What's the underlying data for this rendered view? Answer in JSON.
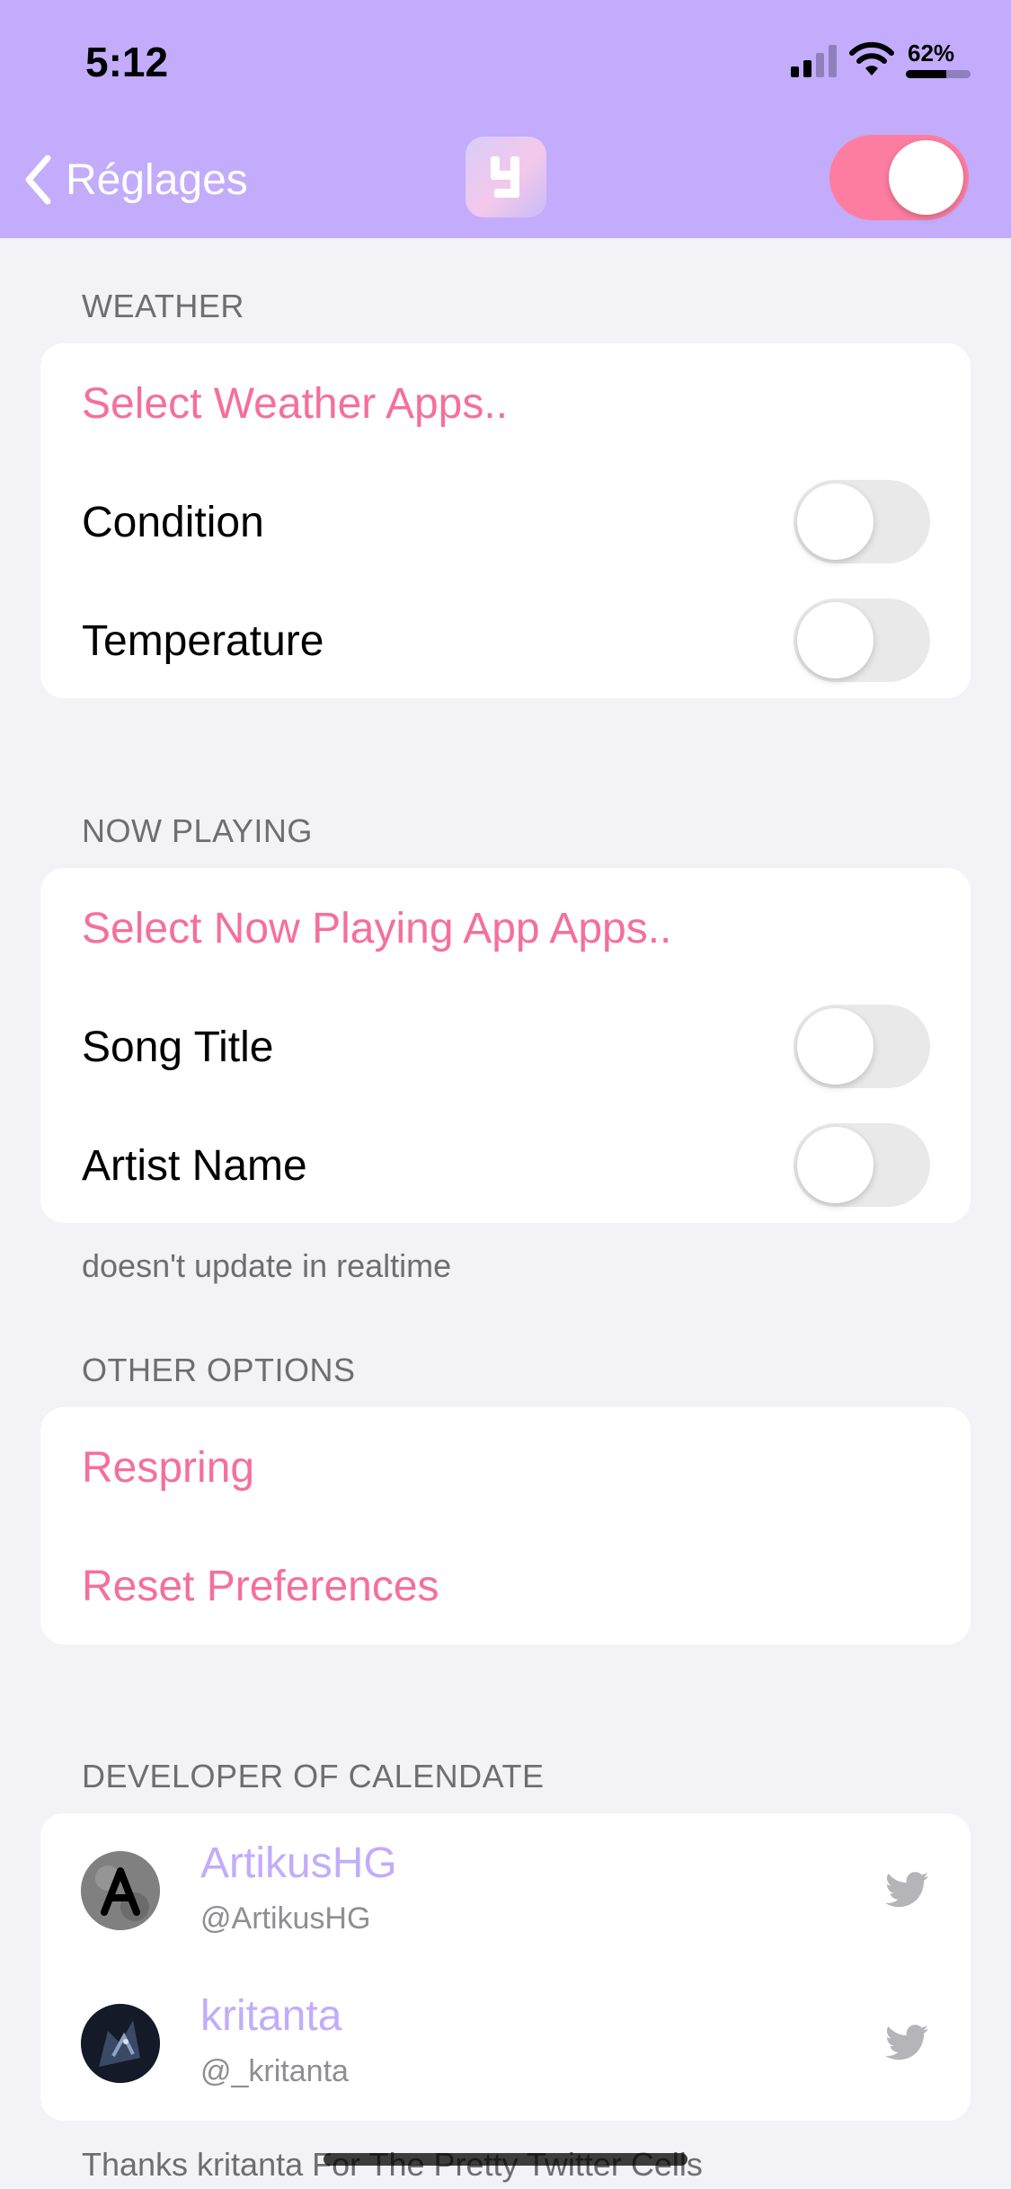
{
  "status_bar": {
    "time": "5:12",
    "battery": "62%",
    "battery_level": 0.62
  },
  "nav": {
    "back_label": "Réglages",
    "enabled": true
  },
  "sections": {
    "weather": {
      "header": "WEATHER",
      "select": "Select Weather Apps..",
      "rows": [
        {
          "label": "Condition",
          "on": false
        },
        {
          "label": "Temperature",
          "on": false
        }
      ]
    },
    "now_playing": {
      "header": "NOW PLAYING",
      "select": "Select Now Playing App Apps..",
      "rows": [
        {
          "label": "Song Title",
          "on": false
        },
        {
          "label": "Artist Name",
          "on": false
        }
      ],
      "footer": "doesn't update in realtime"
    },
    "other": {
      "header": "OTHER OPTIONS",
      "respring": "Respring",
      "reset": "Reset Preferences"
    },
    "developer": {
      "header": "DEVELOPER OF CALENDATE",
      "devs": [
        {
          "name": "ArtikusHG",
          "handle": "@ArtikusHG"
        },
        {
          "name": "kritanta",
          "handle": "@_kritanta"
        }
      ],
      "footer": "Thanks kritanta For The Pretty Twitter Cells"
    }
  },
  "colors": {
    "accent_pink": "#f56f9b",
    "accent_purple": "#c2acfb",
    "background": "#f2f2f7"
  },
  "icons": [
    "chevron-left-icon",
    "signal-icon",
    "wifi-icon",
    "battery-icon",
    "app-icon",
    "twitter-icon"
  ]
}
